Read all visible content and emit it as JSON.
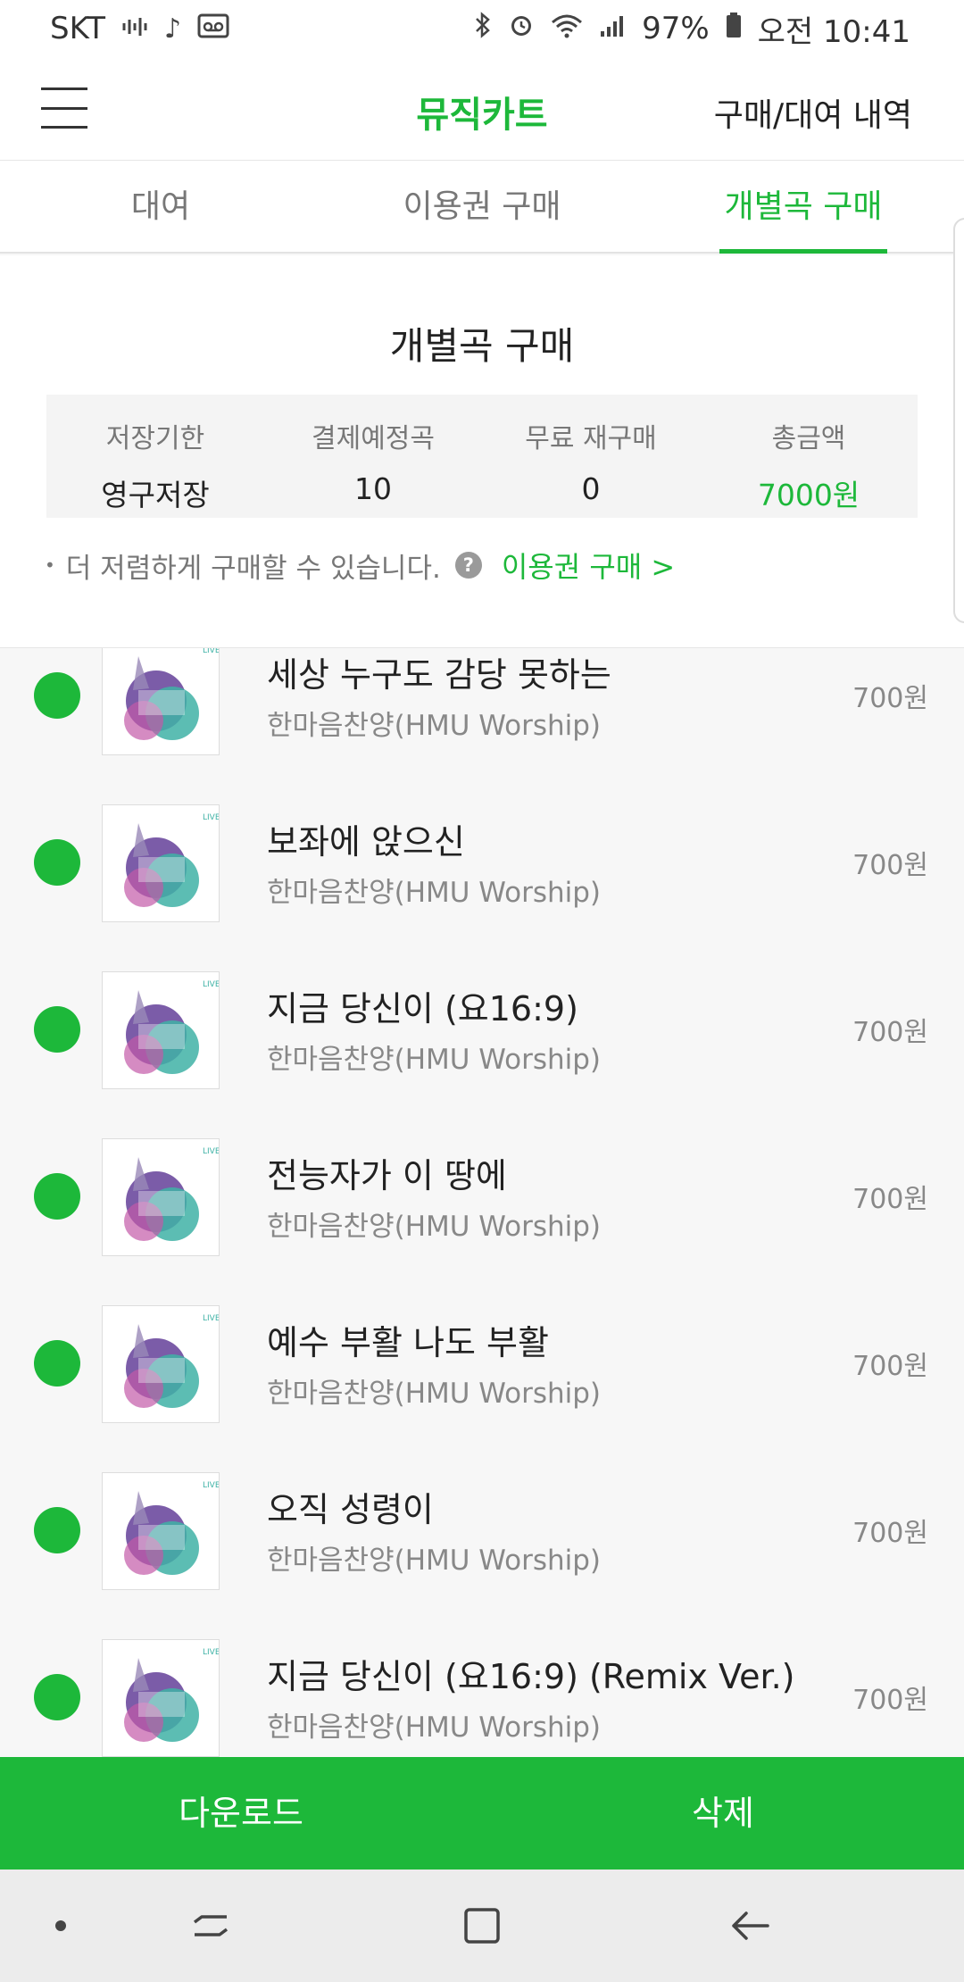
{
  "status_bar": {
    "carrier": "SKT",
    "battery": "97%",
    "time": "오전 10:41"
  },
  "header": {
    "title": "뮤직카트",
    "history_link": "구매/대여 내역"
  },
  "tabs": [
    {
      "label": "대여",
      "active": false
    },
    {
      "label": "이용권 구매",
      "active": false
    },
    {
      "label": "개별곡 구매",
      "active": true
    }
  ],
  "summary": {
    "title": "개별곡 구매",
    "stats": [
      {
        "label": "저장기한",
        "value": "영구저장"
      },
      {
        "label": "결제예정곡",
        "value": "10"
      },
      {
        "label": "무료 재구매",
        "value": "0"
      },
      {
        "label": "총금액",
        "value": "7000원"
      }
    ],
    "notice": "더 저렴하게 구매할 수 있습니다.",
    "pass_link": "이용권 구매 >"
  },
  "songs": [
    {
      "title": "세상 누구도 감당 못하는",
      "artist": "한마음찬양(HMU Worship)",
      "price": "700원",
      "selected": true
    },
    {
      "title": "보좌에 앉으신",
      "artist": "한마음찬양(HMU Worship)",
      "price": "700원",
      "selected": true
    },
    {
      "title": "지금 당신이 (요16:9)",
      "artist": "한마음찬양(HMU Worship)",
      "price": "700원",
      "selected": true
    },
    {
      "title": "전능자가 이 땅에",
      "artist": "한마음찬양(HMU Worship)",
      "price": "700원",
      "selected": true
    },
    {
      "title": "예수 부활 나도 부활",
      "artist": "한마음찬양(HMU Worship)",
      "price": "700원",
      "selected": true
    },
    {
      "title": "오직 성령이",
      "artist": "한마음찬양(HMU Worship)",
      "price": "700원",
      "selected": true
    },
    {
      "title": "지금 당신이 (요16:9) (Remix Ver.)",
      "artist": "한마음찬양(HMU Worship)",
      "price": "700원",
      "selected": true
    }
  ],
  "actions": {
    "download": "다운로드",
    "delete": "삭제"
  },
  "colors": {
    "accent": "#1db83a"
  }
}
